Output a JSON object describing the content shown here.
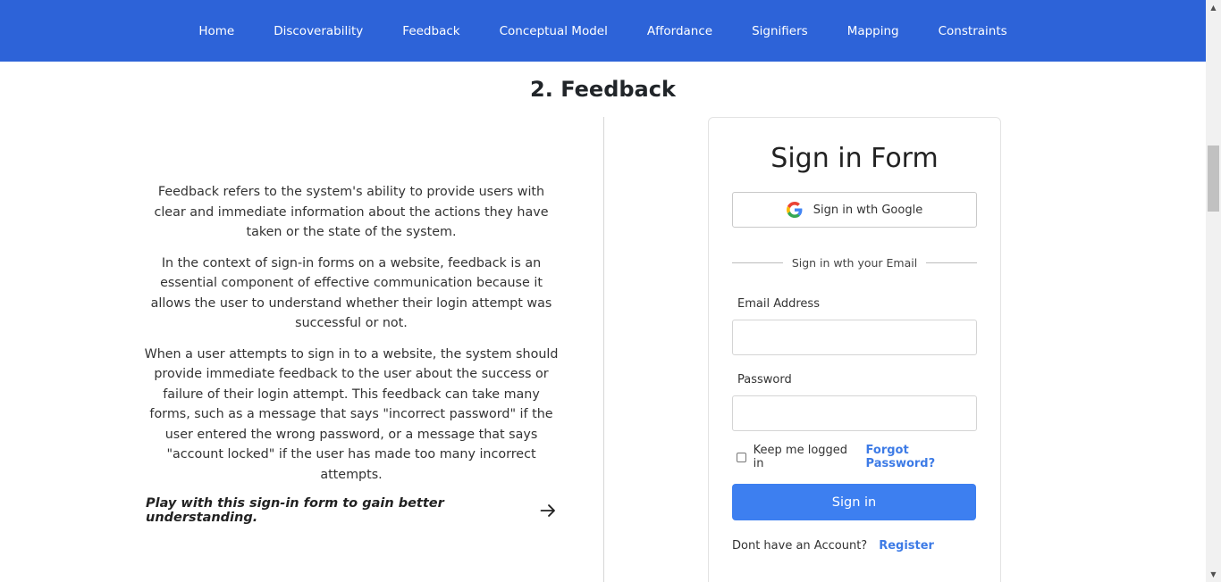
{
  "nav": {
    "items": [
      {
        "label": "Home"
      },
      {
        "label": "Discoverability"
      },
      {
        "label": "Feedback"
      },
      {
        "label": "Conceptual Model"
      },
      {
        "label": "Affordance"
      },
      {
        "label": "Signifiers"
      },
      {
        "label": "Mapping"
      },
      {
        "label": "Constraints"
      }
    ],
    "background": "#2d63d8"
  },
  "section": {
    "title": "2. Feedback",
    "paragraphs": [
      "Feedback refers to the system's ability to provide users with clear and immediate information about the actions they have taken or the state of the system.",
      "In the context of sign-in forms on a website, feedback is an essential component of effective communication because it allows the user to understand whether their login attempt was successful or not.",
      "When a user attempts to sign in to a website, the system should provide immediate feedback to the user about the success or failure of their login attempt. This feedback can take many forms, such as a message that says \"incorrect password\" if the user entered the wrong password, or a message that says \"account locked\" if the user has made too many incorrect attempts."
    ],
    "cta": "Play with this sign-in form to gain better understanding.",
    "cta_icon": "arrow-right-icon"
  },
  "form": {
    "title": "Sign in Form",
    "google_button": "Sign in wth Google",
    "google_icon": "google-icon",
    "divider_text": "Sign in wth your Email",
    "email_label": "Email Address",
    "email_value": "",
    "password_label": "Password",
    "password_value": "",
    "remember_label": "Keep me logged in",
    "remember_checked": false,
    "forgot_link": "Forgot Password?",
    "submit": "Sign in",
    "no_account": "Dont have an Account?",
    "register_link": "Register",
    "accent": "#3d7ff0"
  }
}
